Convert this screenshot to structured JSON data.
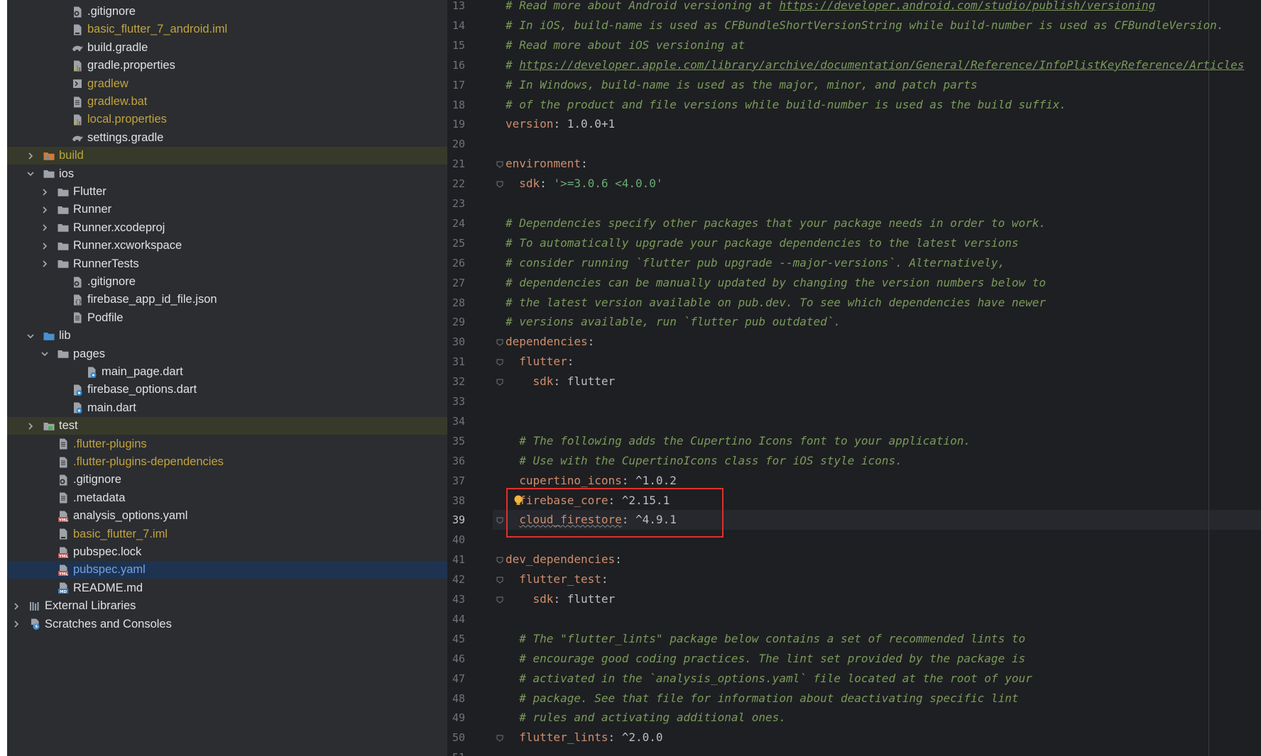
{
  "project_tree": {
    "rows": [
      {
        "label": ".gitignore",
        "type": "file",
        "icon": "gitignore-file-icon",
        "color": "default",
        "depth": 3
      },
      {
        "label": "basic_flutter_7_android.iml",
        "type": "file",
        "icon": "iml-file-icon",
        "color": "yellow",
        "depth": 3
      },
      {
        "label": "build.gradle",
        "type": "file",
        "icon": "gradle-elephant-icon",
        "color": "default",
        "depth": 3
      },
      {
        "label": "gradle.properties",
        "type": "file",
        "icon": "properties-file-icon",
        "color": "default",
        "depth": 3
      },
      {
        "label": "gradlew",
        "type": "file",
        "icon": "shell-script-icon",
        "color": "yellow",
        "depth": 3
      },
      {
        "label": "gradlew.bat",
        "type": "file",
        "icon": "text-file-icon",
        "color": "yellow",
        "depth": 3
      },
      {
        "label": "local.properties",
        "type": "file",
        "icon": "properties-file-icon",
        "color": "yellow",
        "depth": 3
      },
      {
        "label": "settings.gradle",
        "type": "file",
        "icon": "gradle-elephant-icon",
        "color": "default",
        "depth": 3
      },
      {
        "label": "build",
        "type": "folder",
        "icon": "excluded-folder-icon",
        "color": "olive",
        "depth": 1,
        "collapsed": true,
        "highlight": "olive"
      },
      {
        "label": "ios",
        "type": "folder",
        "icon": "folder-icon",
        "color": "default",
        "depth": 1,
        "expanded": true
      },
      {
        "label": "Flutter",
        "type": "folder",
        "icon": "folder-icon",
        "color": "default",
        "depth": 2,
        "collapsed": true
      },
      {
        "label": "Runner",
        "type": "folder",
        "icon": "folder-icon",
        "color": "default",
        "depth": 2,
        "collapsed": true
      },
      {
        "label": "Runner.xcodeproj",
        "type": "folder",
        "icon": "folder-icon",
        "color": "default",
        "depth": 2,
        "collapsed": true
      },
      {
        "label": "Runner.xcworkspace",
        "type": "folder",
        "icon": "folder-icon",
        "color": "default",
        "depth": 2,
        "collapsed": true
      },
      {
        "label": "RunnerTests",
        "type": "folder",
        "icon": "folder-icon",
        "color": "default",
        "depth": 2,
        "collapsed": true
      },
      {
        "label": ".gitignore",
        "type": "file",
        "icon": "gitignore-file-icon",
        "color": "default",
        "depth": 3
      },
      {
        "label": "firebase_app_id_file.json",
        "type": "file",
        "icon": "json-file-icon",
        "color": "default",
        "depth": 3
      },
      {
        "label": "Podfile",
        "type": "file",
        "icon": "text-file-icon",
        "color": "default",
        "depth": 3
      },
      {
        "label": "lib",
        "type": "folder",
        "icon": "source-folder-icon",
        "color": "default",
        "depth": 1,
        "expanded": true
      },
      {
        "label": "pages",
        "type": "folder",
        "icon": "folder-icon",
        "color": "default",
        "depth": 2,
        "expanded": true
      },
      {
        "label": "main_page.dart",
        "type": "file",
        "icon": "dart-file-icon",
        "color": "default",
        "depth": 4
      },
      {
        "label": "firebase_options.dart",
        "type": "file",
        "icon": "dart-file-icon",
        "color": "default",
        "depth": 3
      },
      {
        "label": "main.dart",
        "type": "file",
        "icon": "dart-file-icon",
        "color": "default",
        "depth": 3
      },
      {
        "label": "test",
        "type": "folder",
        "icon": "test-folder-icon",
        "color": "default",
        "depth": 1,
        "collapsed": true,
        "highlight": "olive"
      },
      {
        "label": ".flutter-plugins",
        "type": "file",
        "icon": "text-file-icon",
        "color": "yellow",
        "depth": 2
      },
      {
        "label": ".flutter-plugins-dependencies",
        "type": "file",
        "icon": "text-file-icon",
        "color": "yellow",
        "depth": 2
      },
      {
        "label": ".gitignore",
        "type": "file",
        "icon": "gitignore-file-icon",
        "color": "default",
        "depth": 2
      },
      {
        "label": ".metadata",
        "type": "file",
        "icon": "text-file-icon",
        "color": "default",
        "depth": 2
      },
      {
        "label": "analysis_options.yaml",
        "type": "file",
        "icon": "yaml-file-icon",
        "color": "default",
        "depth": 2
      },
      {
        "label": "basic_flutter_7.iml",
        "type": "file",
        "icon": "iml-file-icon",
        "color": "yellow",
        "depth": 2
      },
      {
        "label": "pubspec.lock",
        "type": "file",
        "icon": "yaml-file-icon",
        "color": "default",
        "depth": 2
      },
      {
        "label": "pubspec.yaml",
        "type": "file",
        "icon": "yaml-file-icon",
        "color": "blue",
        "depth": 2,
        "selected": true
      },
      {
        "label": "README.md",
        "type": "file",
        "icon": "markdown-file-icon",
        "color": "default",
        "depth": 2
      },
      {
        "label": "External Libraries",
        "type": "node",
        "icon": "libraries-icon",
        "color": "default",
        "depth": 0,
        "collapsed": true
      },
      {
        "label": "Scratches and Consoles",
        "type": "node",
        "icon": "scratches-icon",
        "color": "default",
        "depth": 0,
        "collapsed": true
      }
    ]
  },
  "editor": {
    "current_line": 39,
    "lines": [
      {
        "n": 13,
        "tokens": [
          {
            "t": "comment",
            "v": "# Read more about Android versioning at "
          },
          {
            "t": "link",
            "v": "https://developer.android.com/studio/publish/versioning"
          }
        ]
      },
      {
        "n": 14,
        "tokens": [
          {
            "t": "comment",
            "v": "# In iOS, build-name is used as CFBundleShortVersionString while build-number is used as CFBundleVersion."
          }
        ]
      },
      {
        "n": 15,
        "tokens": [
          {
            "t": "comment",
            "v": "# Read more about iOS versioning at"
          }
        ]
      },
      {
        "n": 16,
        "tokens": [
          {
            "t": "comment",
            "v": "# "
          },
          {
            "t": "link",
            "v": "https://developer.apple.com/library/archive/documentation/General/Reference/InfoPlistKeyReference/Articles"
          }
        ]
      },
      {
        "n": 17,
        "tokens": [
          {
            "t": "comment",
            "v": "# In Windows, build-name is used as the major, minor, and patch parts"
          }
        ]
      },
      {
        "n": 18,
        "tokens": [
          {
            "t": "comment",
            "v": "# of the product and file versions while build-number is used as the build suffix."
          }
        ]
      },
      {
        "n": 19,
        "tokens": [
          {
            "t": "key",
            "v": "version"
          },
          {
            "t": "val",
            "v": ": 1.0.0+1"
          }
        ]
      },
      {
        "n": 20,
        "tokens": []
      },
      {
        "n": 21,
        "fold": true,
        "tokens": [
          {
            "t": "key",
            "v": "environment"
          },
          {
            "t": "val",
            "v": ":"
          }
        ]
      },
      {
        "n": 22,
        "fold": true,
        "tokens": [
          {
            "t": "val",
            "v": "  "
          },
          {
            "t": "key",
            "v": "sdk"
          },
          {
            "t": "val",
            "v": ": "
          },
          {
            "t": "str",
            "v": "'>=3.0.6 <4.0.0'"
          }
        ]
      },
      {
        "n": 23,
        "tokens": []
      },
      {
        "n": 24,
        "tokens": [
          {
            "t": "comment",
            "v": "# Dependencies specify other packages that your package needs in order to work."
          }
        ]
      },
      {
        "n": 25,
        "tokens": [
          {
            "t": "comment",
            "v": "# To automatically upgrade your package dependencies to the latest versions"
          }
        ]
      },
      {
        "n": 26,
        "tokens": [
          {
            "t": "comment",
            "v": "# consider running `flutter pub upgrade --major-versions`. Alternatively,"
          }
        ]
      },
      {
        "n": 27,
        "tokens": [
          {
            "t": "comment",
            "v": "# dependencies can be manually updated by changing the version numbers below to"
          }
        ]
      },
      {
        "n": 28,
        "tokens": [
          {
            "t": "comment",
            "v": "# the latest version available on pub.dev. To see which dependencies have newer"
          }
        ]
      },
      {
        "n": 29,
        "tokens": [
          {
            "t": "comment",
            "v": "# versions available, run `flutter pub outdated`."
          }
        ]
      },
      {
        "n": 30,
        "fold": true,
        "tokens": [
          {
            "t": "key",
            "v": "dependencies"
          },
          {
            "t": "val",
            "v": ":"
          }
        ]
      },
      {
        "n": 31,
        "fold": true,
        "tokens": [
          {
            "t": "val",
            "v": "  "
          },
          {
            "t": "key",
            "v": "flutter"
          },
          {
            "t": "val",
            "v": ":"
          }
        ]
      },
      {
        "n": 32,
        "fold": true,
        "tokens": [
          {
            "t": "val",
            "v": "    "
          },
          {
            "t": "key",
            "v": "sdk"
          },
          {
            "t": "val",
            "v": ": flutter"
          }
        ]
      },
      {
        "n": 33,
        "tokens": []
      },
      {
        "n": 34,
        "tokens": []
      },
      {
        "n": 35,
        "tokens": [
          {
            "t": "val",
            "v": "  "
          },
          {
            "t": "comment",
            "v": "# The following adds the Cupertino Icons font to your application."
          }
        ]
      },
      {
        "n": 36,
        "tokens": [
          {
            "t": "val",
            "v": "  "
          },
          {
            "t": "comment",
            "v": "# Use with the CupertinoIcons class for iOS style icons."
          }
        ]
      },
      {
        "n": 37,
        "tokens": [
          {
            "t": "val",
            "v": "  "
          },
          {
            "t": "key",
            "v": "cupertino_icons"
          },
          {
            "t": "val",
            "v": ": ^1.0.2"
          }
        ]
      },
      {
        "n": 38,
        "tokens": [
          {
            "t": "val",
            "v": "  "
          },
          {
            "t": "key",
            "v": "firebase_core"
          },
          {
            "t": "val",
            "v": ": ^2.15.1"
          }
        ]
      },
      {
        "n": 39,
        "fold": true,
        "tokens": [
          {
            "t": "val",
            "v": "  "
          },
          {
            "t": "key",
            "v": "cloud_firestore",
            "squiggle": true
          },
          {
            "t": "val",
            "v": ": ^4.9.1"
          }
        ]
      },
      {
        "n": 40,
        "tokens": []
      },
      {
        "n": 41,
        "fold": true,
        "tokens": [
          {
            "t": "key",
            "v": "dev_dependencies"
          },
          {
            "t": "val",
            "v": ":"
          }
        ]
      },
      {
        "n": 42,
        "fold": true,
        "tokens": [
          {
            "t": "val",
            "v": "  "
          },
          {
            "t": "key",
            "v": "flutter_test"
          },
          {
            "t": "val",
            "v": ":"
          }
        ]
      },
      {
        "n": 43,
        "fold": true,
        "tokens": [
          {
            "t": "val",
            "v": "    "
          },
          {
            "t": "key",
            "v": "sdk"
          },
          {
            "t": "val",
            "v": ": flutter"
          }
        ]
      },
      {
        "n": 44,
        "tokens": []
      },
      {
        "n": 45,
        "tokens": [
          {
            "t": "val",
            "v": "  "
          },
          {
            "t": "comment",
            "v": "# The \"flutter_lints\" package below contains a set of recommended lints to"
          }
        ]
      },
      {
        "n": 46,
        "tokens": [
          {
            "t": "val",
            "v": "  "
          },
          {
            "t": "comment",
            "v": "# encourage good coding practices. The lint set provided by the package is"
          }
        ]
      },
      {
        "n": 47,
        "tokens": [
          {
            "t": "val",
            "v": "  "
          },
          {
            "t": "comment",
            "v": "# activated in the `analysis_options.yaml` file located at the root of your"
          }
        ]
      },
      {
        "n": 48,
        "tokens": [
          {
            "t": "val",
            "v": "  "
          },
          {
            "t": "comment",
            "v": "# package. See that file for information about deactivating specific lint"
          }
        ]
      },
      {
        "n": 49,
        "tokens": [
          {
            "t": "val",
            "v": "  "
          },
          {
            "t": "comment",
            "v": "# rules and activating additional ones."
          }
        ]
      },
      {
        "n": 50,
        "fold": true,
        "tokens": [
          {
            "t": "val",
            "v": "  "
          },
          {
            "t": "key",
            "v": "flutter_lints"
          },
          {
            "t": "val",
            "v": ": ^2.0.0"
          }
        ]
      },
      {
        "n": 51,
        "tokens": []
      }
    ]
  },
  "annotation": {
    "color": "#e0302a",
    "lines": [
      38,
      39
    ]
  },
  "colors": {
    "comment": "#7a9a5a",
    "key": "#cf8e6d",
    "string": "#6aab73",
    "selected_file": "#6fa3e8",
    "ignored_file": "#c2a33e"
  }
}
